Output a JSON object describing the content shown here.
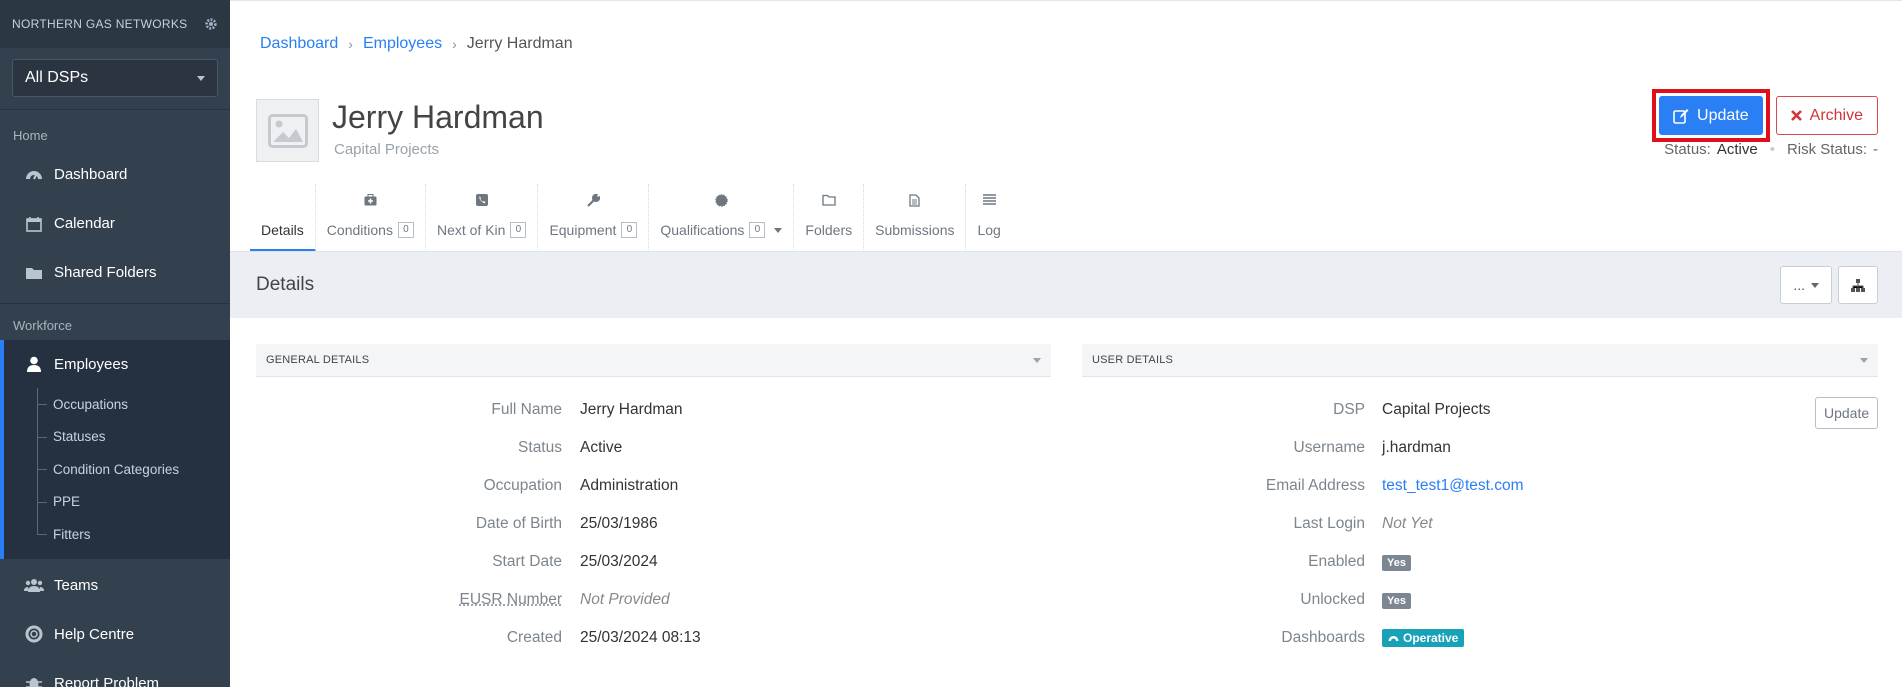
{
  "sidebar": {
    "brand": "NORTHERN GAS NETWORKS",
    "dsp_select": "All DSPs",
    "section_home": "Home",
    "home_items": [
      "Dashboard",
      "Calendar",
      "Shared Folders"
    ],
    "section_workforce": "Workforce",
    "employees": "Employees",
    "employees_sub": [
      "Occupations",
      "Statuses",
      "Condition Categories",
      "PPE",
      "Fitters"
    ],
    "bottom_items": [
      "Teams",
      "Help Centre",
      "Report Problem"
    ]
  },
  "breadcrumb": {
    "dashboard": "Dashboard",
    "employees": "Employees",
    "current": "Jerry Hardman"
  },
  "employee": {
    "name": "Jerry Hardman",
    "dsp": "Capital Projects"
  },
  "actions": {
    "update": "Update",
    "archive": "Archive"
  },
  "status_line": {
    "status_label": "Status:",
    "status_value": "Active",
    "risk_label": "Risk Status:",
    "risk_value": "-"
  },
  "tabs": [
    {
      "label": "Details"
    },
    {
      "label": "Conditions",
      "count": "0"
    },
    {
      "label": "Next of Kin",
      "count": "0"
    },
    {
      "label": "Equipment",
      "count": "0"
    },
    {
      "label": "Qualifications",
      "count": "0"
    },
    {
      "label": "Folders"
    },
    {
      "label": "Submissions"
    },
    {
      "label": "Log"
    }
  ],
  "details": {
    "title": "Details",
    "more_button": "..."
  },
  "general": {
    "header": "GENERAL DETAILS",
    "fields": [
      {
        "label": "Full Name",
        "value": "Jerry Hardman"
      },
      {
        "label": "Status",
        "value": "Active"
      },
      {
        "label": "Occupation",
        "value": "Administration"
      },
      {
        "label": "Date of Birth",
        "value": "25/03/1986"
      },
      {
        "label": "Start Date",
        "value": "25/03/2024"
      },
      {
        "label": "EUSR Number",
        "value": "Not Provided"
      },
      {
        "label": "Created",
        "value": "25/03/2024 08:13"
      }
    ]
  },
  "user": {
    "header": "USER DETAILS",
    "update_button": "Update",
    "fields": [
      {
        "label": "DSP",
        "value": "Capital Projects"
      },
      {
        "label": "Username",
        "value": "j.hardman"
      },
      {
        "label": "Email Address",
        "value": "test_test1@test.com"
      },
      {
        "label": "Last Login",
        "value": "Not Yet"
      },
      {
        "label": "Enabled",
        "value": "Yes"
      },
      {
        "label": "Unlocked",
        "value": "Yes"
      },
      {
        "label": "Dashboards",
        "value": "Operative"
      }
    ]
  },
  "colors": {
    "accent": "#2a7ff5",
    "sidebar_bg": "#33404e",
    "danger": "#d0353a",
    "highlight": "#e0101a",
    "info": "#17a2b8"
  }
}
